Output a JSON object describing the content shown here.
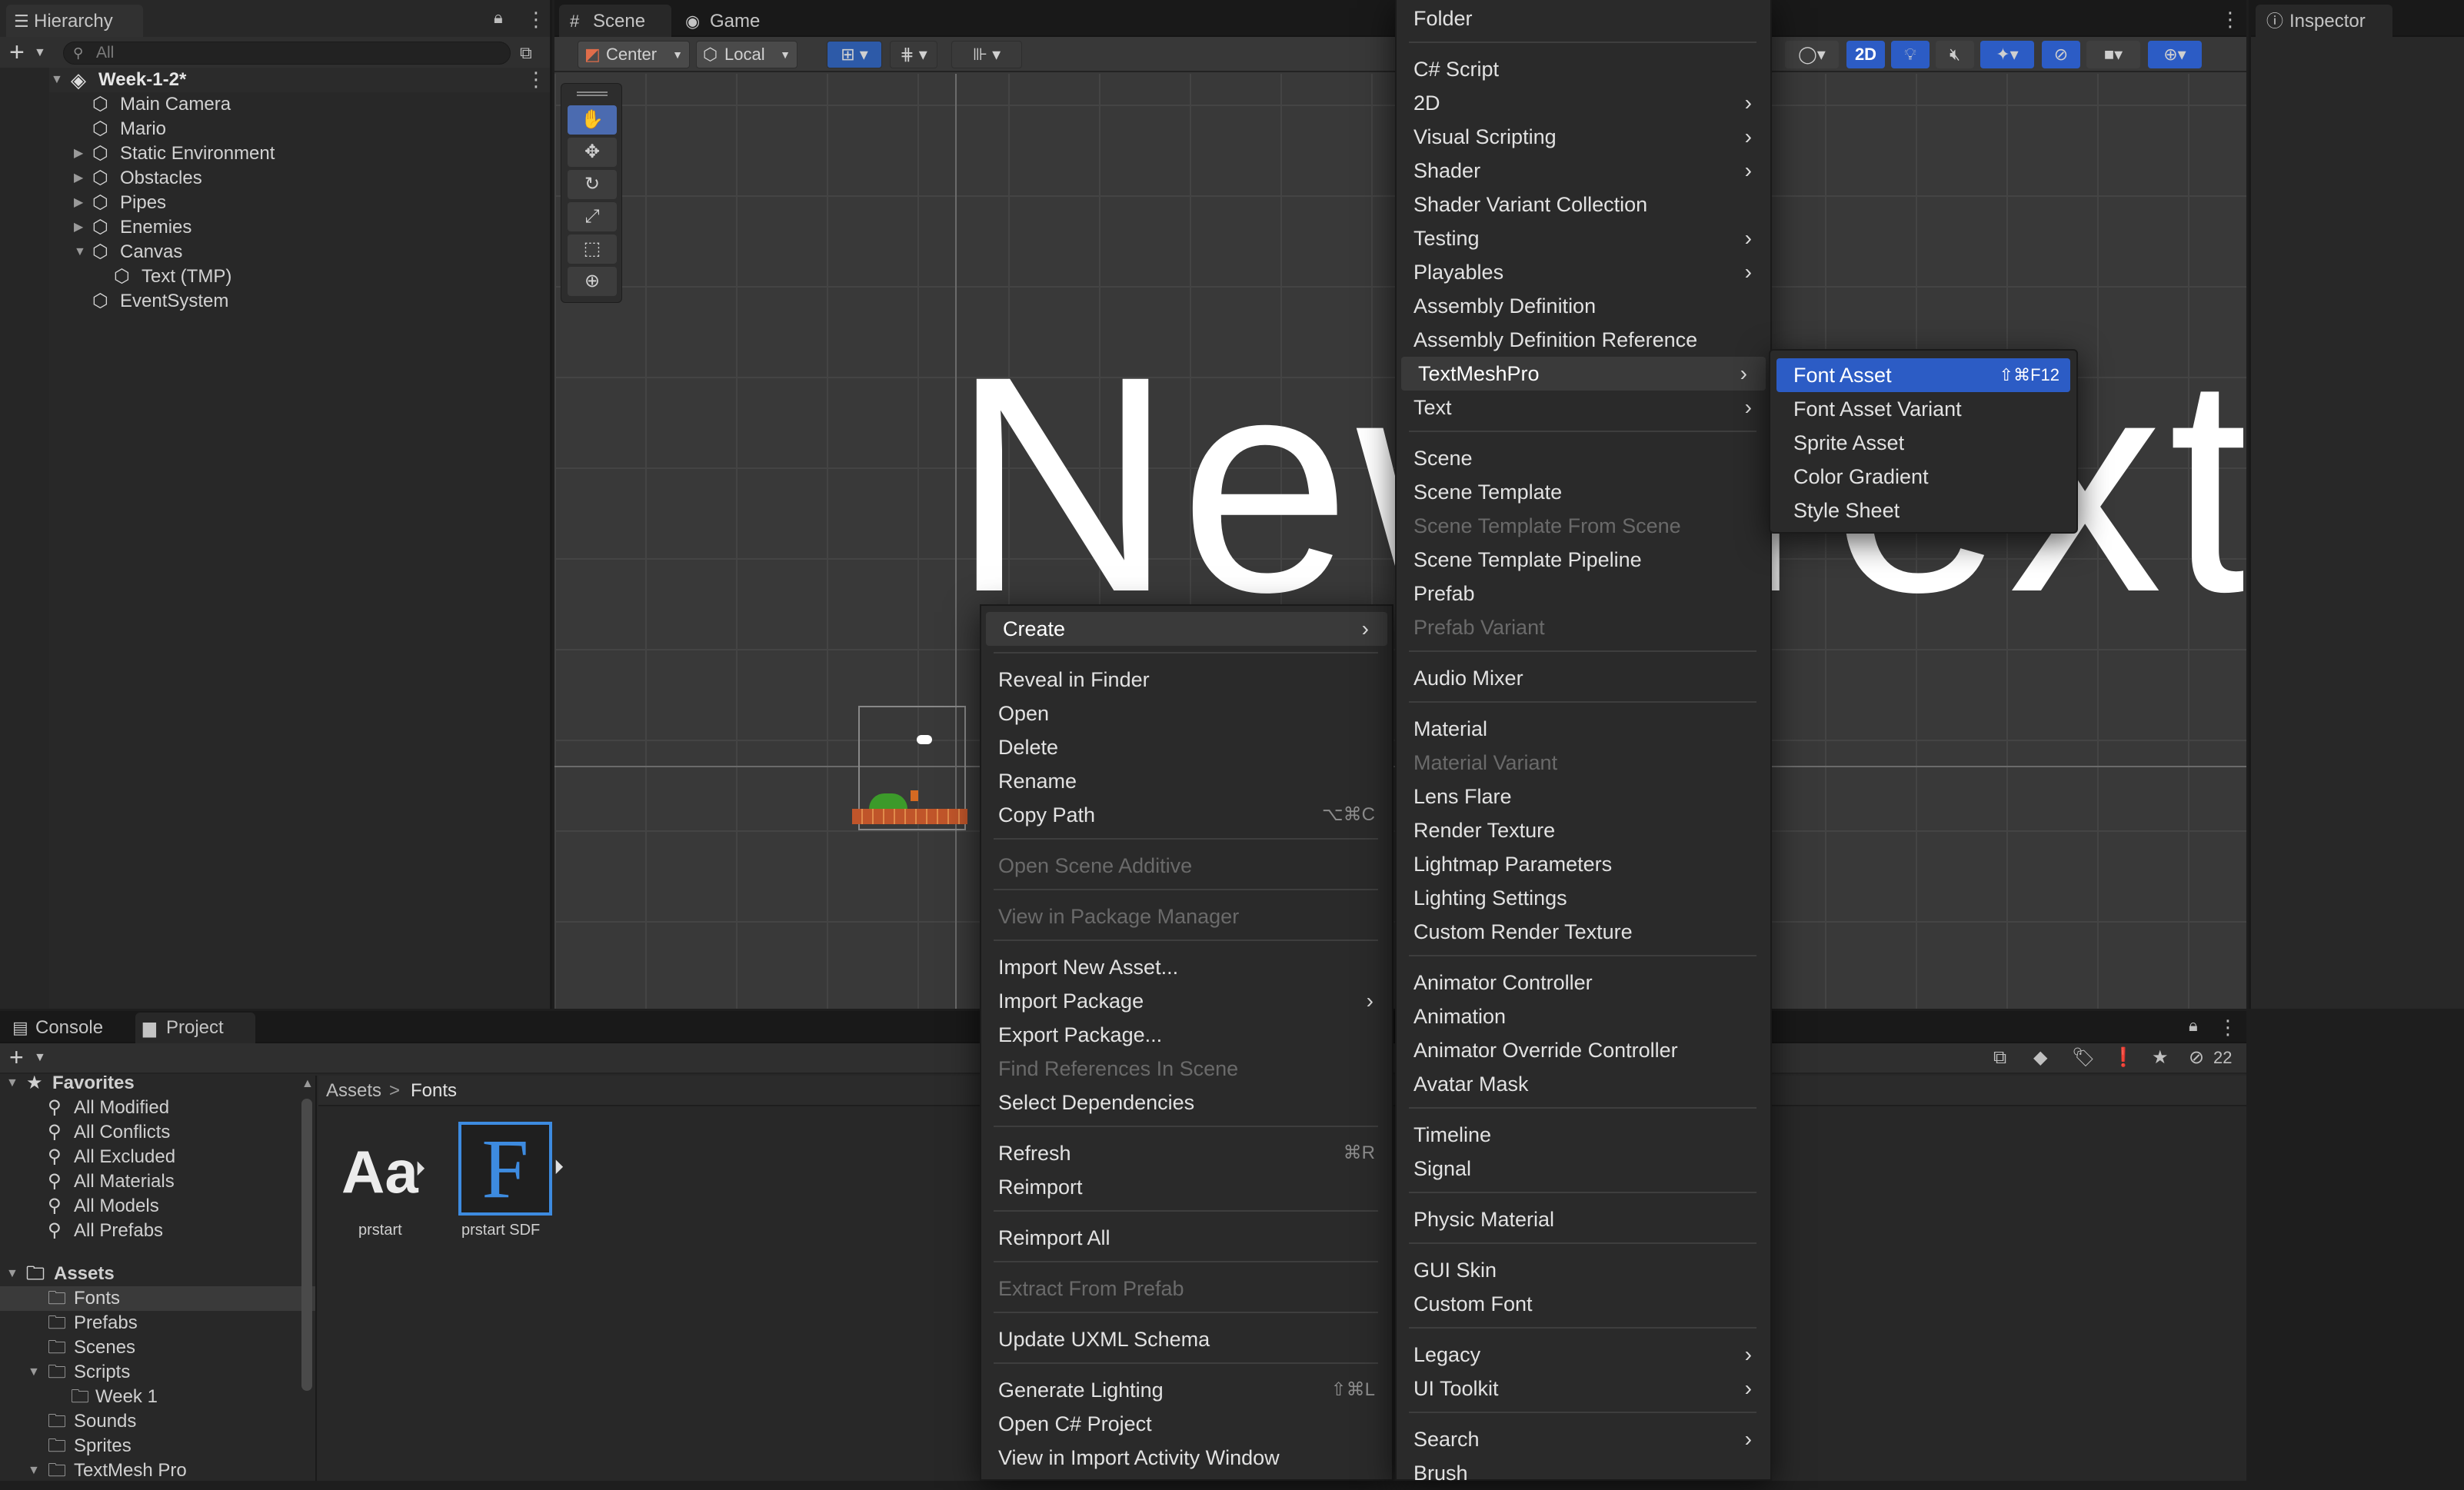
{
  "hierarchy": {
    "tab_label": "Hierarchy",
    "search_placeholder": "All",
    "scene_name": "Week-1-2*",
    "items": [
      {
        "label": "Main Camera"
      },
      {
        "label": "Mario"
      },
      {
        "label": "Static Environment"
      },
      {
        "label": "Obstacles"
      },
      {
        "label": "Pipes"
      },
      {
        "label": "Enemies"
      },
      {
        "label": "Canvas"
      },
      {
        "label": "Text (TMP)"
      },
      {
        "label": "EventSystem"
      }
    ]
  },
  "scene": {
    "tabs": [
      {
        "label": "Scene"
      },
      {
        "label": "Game"
      }
    ],
    "pivot_label": "Center",
    "space_label": "Local",
    "mode_2d_label": "2D",
    "canvas_text": "New Text"
  },
  "inspector": {
    "tab_label": "Inspector"
  },
  "project": {
    "tabs": [
      {
        "label": "Console"
      },
      {
        "label": "Project"
      }
    ],
    "favorites_label": "Favorites",
    "favorites": [
      {
        "label": "All Modified"
      },
      {
        "label": "All Conflicts"
      },
      {
        "label": "All Excluded"
      },
      {
        "label": "All Materials"
      },
      {
        "label": "All Models"
      },
      {
        "label": "All Prefabs"
      }
    ],
    "assets_label": "Assets",
    "folders": [
      {
        "label": "Fonts"
      },
      {
        "label": "Prefabs"
      },
      {
        "label": "Scenes"
      },
      {
        "label": "Scripts"
      },
      {
        "label": "Week 1"
      },
      {
        "label": "Sounds"
      },
      {
        "label": "Sprites"
      },
      {
        "label": "TextMesh Pro"
      }
    ],
    "breadcrumb": {
      "root": "Assets",
      "current": "Fonts"
    },
    "files": [
      {
        "label": "prstart",
        "glyph": "Aa"
      },
      {
        "label": "prstart SDF",
        "glyph": "F"
      }
    ],
    "hidden_count": "22"
  },
  "context_menu": {
    "items": [
      {
        "label": "Create"
      },
      {
        "label": "Reveal in Finder"
      },
      {
        "label": "Open"
      },
      {
        "label": "Delete"
      },
      {
        "label": "Rename"
      },
      {
        "label": "Copy Path",
        "shortcut": "⌥⌘C"
      },
      {
        "label": "Open Scene Additive"
      },
      {
        "label": "View in Package Manager"
      },
      {
        "label": "Import New Asset..."
      },
      {
        "label": "Import Package"
      },
      {
        "label": "Export Package..."
      },
      {
        "label": "Find References In Scene"
      },
      {
        "label": "Select Dependencies"
      },
      {
        "label": "Refresh",
        "shortcut": "⌘R"
      },
      {
        "label": "Reimport"
      },
      {
        "label": "Reimport All"
      },
      {
        "label": "Extract From Prefab"
      },
      {
        "label": "Update UXML Schema"
      },
      {
        "label": "Generate Lighting",
        "shortcut": "⇧⌘L"
      },
      {
        "label": "Open C# Project"
      },
      {
        "label": "View in Import Activity Window"
      }
    ]
  },
  "create_menu": {
    "items": [
      {
        "label": "Folder"
      },
      {
        "label": "C# Script"
      },
      {
        "label": "2D"
      },
      {
        "label": "Visual Scripting"
      },
      {
        "label": "Shader"
      },
      {
        "label": "Shader Variant Collection"
      },
      {
        "label": "Testing"
      },
      {
        "label": "Playables"
      },
      {
        "label": "Assembly Definition"
      },
      {
        "label": "Assembly Definition Reference"
      },
      {
        "label": "TextMeshPro"
      },
      {
        "label": "Text"
      },
      {
        "label": "Scene"
      },
      {
        "label": "Scene Template"
      },
      {
        "label": "Scene Template From Scene"
      },
      {
        "label": "Scene Template Pipeline"
      },
      {
        "label": "Prefab"
      },
      {
        "label": "Prefab Variant"
      },
      {
        "label": "Audio Mixer"
      },
      {
        "label": "Material"
      },
      {
        "label": "Material Variant"
      },
      {
        "label": "Lens Flare"
      },
      {
        "label": "Render Texture"
      },
      {
        "label": "Lightmap Parameters"
      },
      {
        "label": "Lighting Settings"
      },
      {
        "label": "Custom Render Texture"
      },
      {
        "label": "Animator Controller"
      },
      {
        "label": "Animation"
      },
      {
        "label": "Animator Override Controller"
      },
      {
        "label": "Avatar Mask"
      },
      {
        "label": "Timeline"
      },
      {
        "label": "Signal"
      },
      {
        "label": "Physic Material"
      },
      {
        "label": "GUI Skin"
      },
      {
        "label": "Custom Font"
      },
      {
        "label": "Legacy"
      },
      {
        "label": "UI Toolkit"
      },
      {
        "label": "Search"
      },
      {
        "label": "Brush"
      }
    ]
  },
  "tmp_menu": {
    "items": [
      {
        "label": "Font Asset",
        "shortcut": "⇧⌘F12"
      },
      {
        "label": "Font Asset Variant"
      },
      {
        "label": "Sprite Asset"
      },
      {
        "label": "Color Gradient"
      },
      {
        "label": "Style Sheet"
      }
    ]
  },
  "colors": {
    "accent": "#2c5cc5",
    "panel": "#282828",
    "scene_bg": "#393939",
    "sdf_blue": "#3d8be0"
  }
}
